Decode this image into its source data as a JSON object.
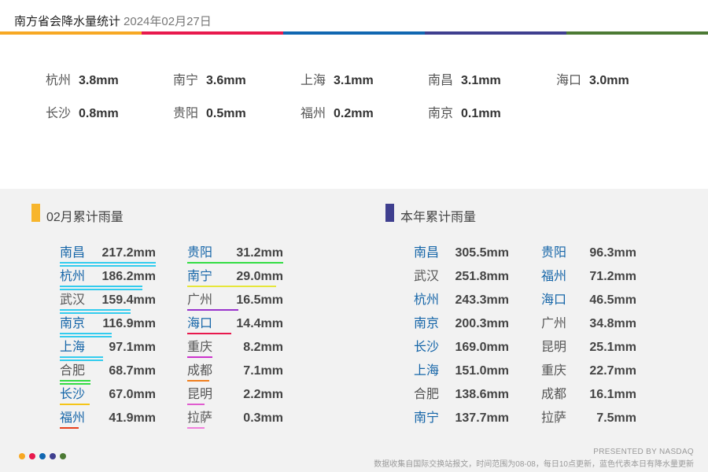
{
  "header": {
    "title": "南方省会降水量统计",
    "date": "2024年02月27日"
  },
  "colors": [
    "#f7a823",
    "#e8194d",
    "#1167b1",
    "#3f3f8f",
    "#4c7a34"
  ],
  "today": [
    {
      "city": "杭州",
      "value": "3.8mm"
    },
    {
      "city": "南宁",
      "value": "3.6mm"
    },
    {
      "city": "上海",
      "value": "3.1mm"
    },
    {
      "city": "南昌",
      "value": "3.1mm"
    },
    {
      "city": "海口",
      "value": "3.0mm"
    },
    {
      "city": "长沙",
      "value": "0.8mm"
    },
    {
      "city": "贵阳",
      "value": "0.5mm"
    },
    {
      "city": "福州",
      "value": "0.2mm"
    },
    {
      "city": "南京",
      "value": "0.1mm"
    }
  ],
  "chart_data": [
    {
      "type": "table",
      "title": "02月累计雨量",
      "unit": "mm",
      "mark_color": "#f7b52c",
      "rows": [
        {
          "city": "南昌",
          "value": 217.2,
          "text": "217.2mm",
          "highlight": true,
          "underline": "#33ccee",
          "underline2": "#33ccee"
        },
        {
          "city": "杭州",
          "value": 186.2,
          "text": "186.2mm",
          "highlight": true,
          "underline": "#33ccee",
          "underline2": "#33ccee"
        },
        {
          "city": "武汉",
          "value": 159.4,
          "text": "159.4mm",
          "highlight": false,
          "underline": "#33ccee",
          "underline2": "#33ccee"
        },
        {
          "city": "南京",
          "value": 116.9,
          "text": "116.9mm",
          "highlight": true,
          "underline": "#33ccee",
          "underline2": "#33ccee"
        },
        {
          "city": "上海",
          "value": 97.1,
          "text": "97.1mm",
          "highlight": true,
          "underline": "#33ccee",
          "underline2": "#33ccee"
        },
        {
          "city": "合肥",
          "value": 68.7,
          "text": "68.7mm",
          "highlight": false,
          "underline": "#33dd44",
          "underline2": "#33dd44"
        },
        {
          "city": "长沙",
          "value": 67.0,
          "text": "67.0mm",
          "highlight": true,
          "underline": "#f5c518"
        },
        {
          "city": "福州",
          "value": 41.9,
          "text": "41.9mm",
          "highlight": true,
          "underline": "#e8401c"
        },
        {
          "city": "贵阳",
          "value": 31.2,
          "text": "31.2mm",
          "highlight": true,
          "underline": "#33dd44"
        },
        {
          "city": "南宁",
          "value": 29.0,
          "text": "29.0mm",
          "highlight": true,
          "underline": "#e6e63a"
        },
        {
          "city": "广州",
          "value": 16.5,
          "text": "16.5mm",
          "highlight": false,
          "underline": "#9933cc"
        },
        {
          "city": "海口",
          "value": 14.4,
          "text": "14.4mm",
          "highlight": true,
          "underline": "#e8194d"
        },
        {
          "city": "重庆",
          "value": 8.2,
          "text": "8.2mm",
          "highlight": false,
          "underline": "#cc33cc"
        },
        {
          "city": "成都",
          "value": 7.1,
          "text": "7.1mm",
          "highlight": false,
          "underline": "#f07f1e"
        },
        {
          "city": "昆明",
          "value": 2.2,
          "text": "2.2mm",
          "highlight": false,
          "underline": "#e05ccf"
        },
        {
          "city": "拉萨",
          "value": 0.3,
          "text": "0.3mm",
          "highlight": false,
          "underline": "#f07fdc"
        }
      ]
    },
    {
      "type": "table",
      "title": "本年累计雨量",
      "unit": "mm",
      "mark_color": "#3f3f8f",
      "rows": [
        {
          "city": "南昌",
          "value": 305.5,
          "text": "305.5mm",
          "highlight": true
        },
        {
          "city": "武汉",
          "value": 251.8,
          "text": "251.8mm",
          "highlight": false
        },
        {
          "city": "杭州",
          "value": 243.3,
          "text": "243.3mm",
          "highlight": true
        },
        {
          "city": "南京",
          "value": 200.3,
          "text": "200.3mm",
          "highlight": true
        },
        {
          "city": "长沙",
          "value": 169.0,
          "text": "169.0mm",
          "highlight": true
        },
        {
          "city": "上海",
          "value": 151.0,
          "text": "151.0mm",
          "highlight": true
        },
        {
          "city": "合肥",
          "value": 138.6,
          "text": "138.6mm",
          "highlight": false
        },
        {
          "city": "南宁",
          "value": 137.7,
          "text": "137.7mm",
          "highlight": true
        },
        {
          "city": "贵阳",
          "value": 96.3,
          "text": "96.3mm",
          "highlight": true
        },
        {
          "city": "福州",
          "value": 71.2,
          "text": "71.2mm",
          "highlight": true
        },
        {
          "city": "海口",
          "value": 46.5,
          "text": "46.5mm",
          "highlight": true
        },
        {
          "city": "广州",
          "value": 34.8,
          "text": "34.8mm",
          "highlight": false
        },
        {
          "city": "昆明",
          "value": 25.1,
          "text": "25.1mm",
          "highlight": false
        },
        {
          "city": "重庆",
          "value": 22.7,
          "text": "22.7mm",
          "highlight": false
        },
        {
          "city": "成都",
          "value": 16.1,
          "text": "16.1mm",
          "highlight": false
        },
        {
          "city": "拉萨",
          "value": 7.5,
          "text": "7.5mm",
          "highlight": false
        }
      ]
    }
  ],
  "footer": {
    "presented": "PRESENTED BY NASDAQ",
    "note": "数据收集自国际交换站报文，时间范围为08-08，每日10点更新，蓝色代表本日有降水量更新"
  }
}
